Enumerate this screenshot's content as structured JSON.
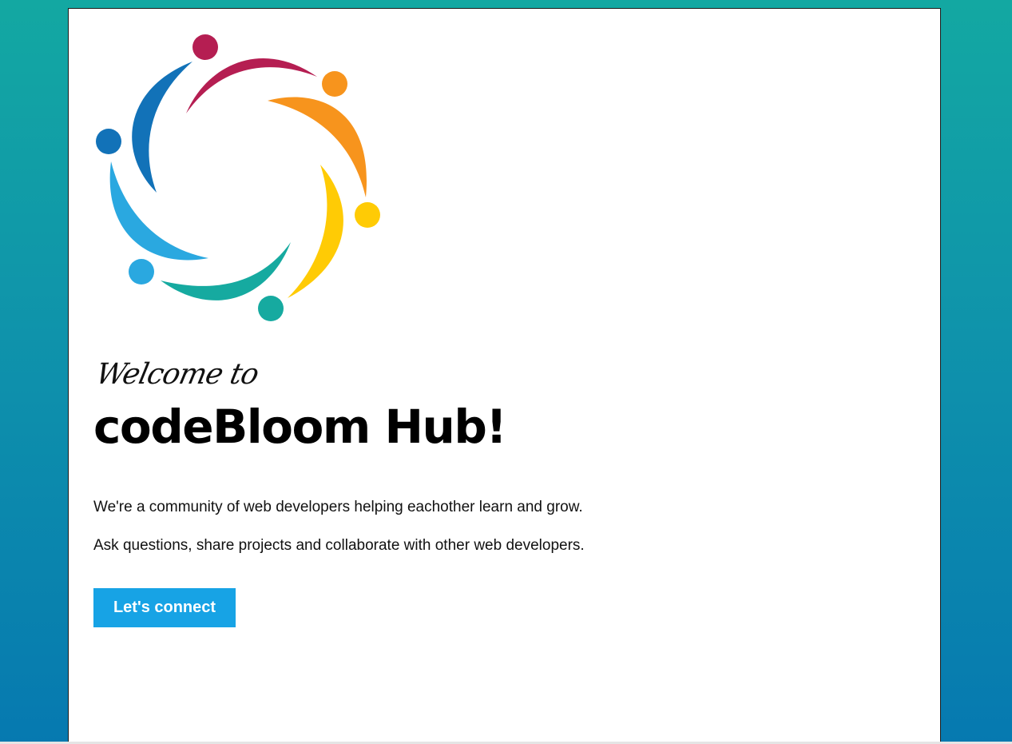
{
  "colors": {
    "background_top": "#13a8a2",
    "background_bottom": "#0679b0",
    "card": "#ffffff",
    "button": "#17a3e5",
    "logo": {
      "magenta": "#b51e52",
      "orange": "#f7941d",
      "yellow": "#ffcb05",
      "teal": "#16aaa0",
      "light_blue": "#2aa8e0",
      "blue": "#1272b8"
    }
  },
  "logo": {
    "icon": "community-people-circle-icon"
  },
  "hero": {
    "welcome": "Welcome to",
    "title": "codeBloom Hub!",
    "paragraphs": [
      "We're a community of web developers helping eachother learn and grow.",
      "Ask questions, share projects and collaborate with other web developers."
    ],
    "cta_label": "Let's connect"
  }
}
